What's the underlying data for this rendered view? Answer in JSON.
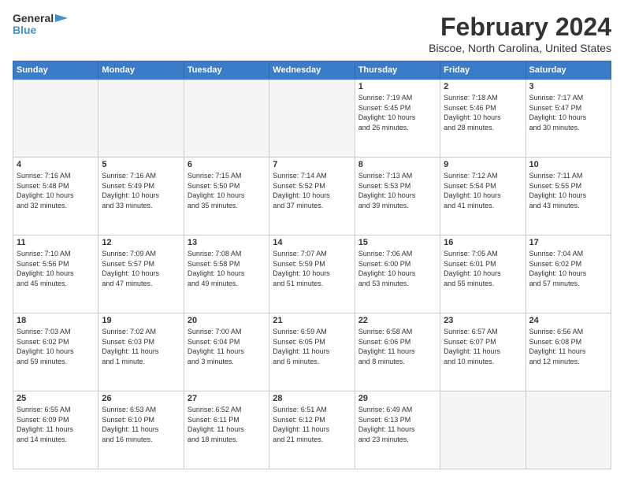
{
  "header": {
    "logo": {
      "line1": "General",
      "line2": "Blue",
      "arrow": "▶"
    },
    "title": "February 2024",
    "location": "Biscoe, North Carolina, United States"
  },
  "weekdays": [
    "Sunday",
    "Monday",
    "Tuesday",
    "Wednesday",
    "Thursday",
    "Friday",
    "Saturday"
  ],
  "weeks": [
    [
      {
        "day": "",
        "info": ""
      },
      {
        "day": "",
        "info": ""
      },
      {
        "day": "",
        "info": ""
      },
      {
        "day": "",
        "info": ""
      },
      {
        "day": "1",
        "info": "Sunrise: 7:19 AM\nSunset: 5:45 PM\nDaylight: 10 hours\nand 26 minutes."
      },
      {
        "day": "2",
        "info": "Sunrise: 7:18 AM\nSunset: 5:46 PM\nDaylight: 10 hours\nand 28 minutes."
      },
      {
        "day": "3",
        "info": "Sunrise: 7:17 AM\nSunset: 5:47 PM\nDaylight: 10 hours\nand 30 minutes."
      }
    ],
    [
      {
        "day": "4",
        "info": "Sunrise: 7:16 AM\nSunset: 5:48 PM\nDaylight: 10 hours\nand 32 minutes."
      },
      {
        "day": "5",
        "info": "Sunrise: 7:16 AM\nSunset: 5:49 PM\nDaylight: 10 hours\nand 33 minutes."
      },
      {
        "day": "6",
        "info": "Sunrise: 7:15 AM\nSunset: 5:50 PM\nDaylight: 10 hours\nand 35 minutes."
      },
      {
        "day": "7",
        "info": "Sunrise: 7:14 AM\nSunset: 5:52 PM\nDaylight: 10 hours\nand 37 minutes."
      },
      {
        "day": "8",
        "info": "Sunrise: 7:13 AM\nSunset: 5:53 PM\nDaylight: 10 hours\nand 39 minutes."
      },
      {
        "day": "9",
        "info": "Sunrise: 7:12 AM\nSunset: 5:54 PM\nDaylight: 10 hours\nand 41 minutes."
      },
      {
        "day": "10",
        "info": "Sunrise: 7:11 AM\nSunset: 5:55 PM\nDaylight: 10 hours\nand 43 minutes."
      }
    ],
    [
      {
        "day": "11",
        "info": "Sunrise: 7:10 AM\nSunset: 5:56 PM\nDaylight: 10 hours\nand 45 minutes."
      },
      {
        "day": "12",
        "info": "Sunrise: 7:09 AM\nSunset: 5:57 PM\nDaylight: 10 hours\nand 47 minutes."
      },
      {
        "day": "13",
        "info": "Sunrise: 7:08 AM\nSunset: 5:58 PM\nDaylight: 10 hours\nand 49 minutes."
      },
      {
        "day": "14",
        "info": "Sunrise: 7:07 AM\nSunset: 5:59 PM\nDaylight: 10 hours\nand 51 minutes."
      },
      {
        "day": "15",
        "info": "Sunrise: 7:06 AM\nSunset: 6:00 PM\nDaylight: 10 hours\nand 53 minutes."
      },
      {
        "day": "16",
        "info": "Sunrise: 7:05 AM\nSunset: 6:01 PM\nDaylight: 10 hours\nand 55 minutes."
      },
      {
        "day": "17",
        "info": "Sunrise: 7:04 AM\nSunset: 6:02 PM\nDaylight: 10 hours\nand 57 minutes."
      }
    ],
    [
      {
        "day": "18",
        "info": "Sunrise: 7:03 AM\nSunset: 6:02 PM\nDaylight: 10 hours\nand 59 minutes."
      },
      {
        "day": "19",
        "info": "Sunrise: 7:02 AM\nSunset: 6:03 PM\nDaylight: 11 hours\nand 1 minute."
      },
      {
        "day": "20",
        "info": "Sunrise: 7:00 AM\nSunset: 6:04 PM\nDaylight: 11 hours\nand 3 minutes."
      },
      {
        "day": "21",
        "info": "Sunrise: 6:59 AM\nSunset: 6:05 PM\nDaylight: 11 hours\nand 6 minutes."
      },
      {
        "day": "22",
        "info": "Sunrise: 6:58 AM\nSunset: 6:06 PM\nDaylight: 11 hours\nand 8 minutes."
      },
      {
        "day": "23",
        "info": "Sunrise: 6:57 AM\nSunset: 6:07 PM\nDaylight: 11 hours\nand 10 minutes."
      },
      {
        "day": "24",
        "info": "Sunrise: 6:56 AM\nSunset: 6:08 PM\nDaylight: 11 hours\nand 12 minutes."
      }
    ],
    [
      {
        "day": "25",
        "info": "Sunrise: 6:55 AM\nSunset: 6:09 PM\nDaylight: 11 hours\nand 14 minutes."
      },
      {
        "day": "26",
        "info": "Sunrise: 6:53 AM\nSunset: 6:10 PM\nDaylight: 11 hours\nand 16 minutes."
      },
      {
        "day": "27",
        "info": "Sunrise: 6:52 AM\nSunset: 6:11 PM\nDaylight: 11 hours\nand 18 minutes."
      },
      {
        "day": "28",
        "info": "Sunrise: 6:51 AM\nSunset: 6:12 PM\nDaylight: 11 hours\nand 21 minutes."
      },
      {
        "day": "29",
        "info": "Sunrise: 6:49 AM\nSunset: 6:13 PM\nDaylight: 11 hours\nand 23 minutes."
      },
      {
        "day": "",
        "info": ""
      },
      {
        "day": "",
        "info": ""
      }
    ]
  ]
}
